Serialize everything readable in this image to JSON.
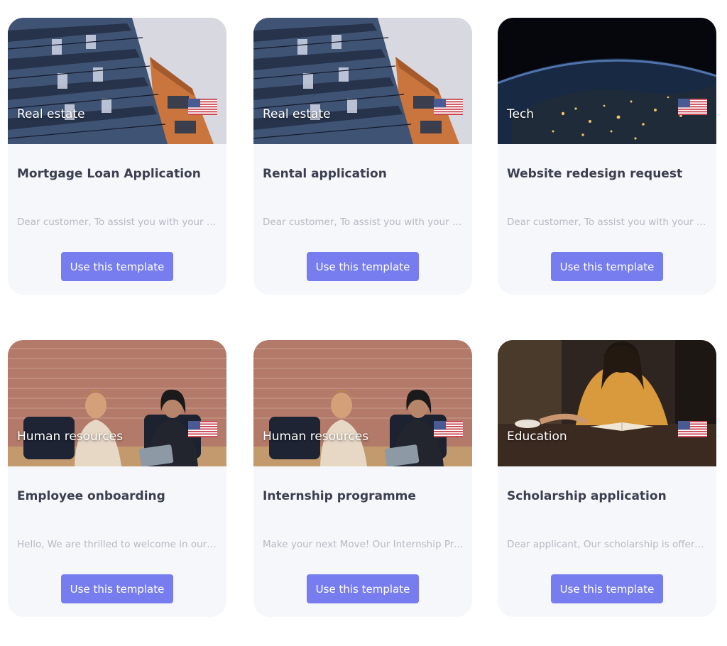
{
  "colors": {
    "card_bg": "#f6f7fa",
    "button_bg": "#777dee",
    "button_text": "#ffffff",
    "title_text": "#3b3f50",
    "desc_text": "#b6b9c4"
  },
  "templates": [
    {
      "category": "Real estate",
      "flag_icon": "us-flag-icon",
      "image": "apartment-building-image",
      "title": "Mortgage Loan Application",
      "description": "Dear customer, To assist you with your Mortgage Loan Application",
      "button_label": "Use this template"
    },
    {
      "category": "Real estate",
      "flag_icon": "us-flag-icon",
      "image": "apartment-building-image",
      "title": "Rental application",
      "description": "Dear customer, To assist you with your tenancy application",
      "button_label": "Use this template"
    },
    {
      "category": "Tech",
      "flag_icon": "us-flag-icon",
      "image": "earth-at-night-image",
      "title": "Website redesign request",
      "description": "Dear customer, To assist you with your website redesign",
      "button_label": "Use this template"
    },
    {
      "category": "Human resources",
      "flag_icon": "us-flag-icon",
      "image": "office-meeting-image",
      "title": "Employee onboarding",
      "description": "Hello, We are thrilled to welcome in our Company",
      "button_label": "Use this template"
    },
    {
      "category": "Human resources",
      "flag_icon": "us-flag-icon",
      "image": "office-meeting-image",
      "title": "Internship programme",
      "description": "Make your next Move! Our Internship Programme",
      "button_label": "Use this template"
    },
    {
      "category": "Education",
      "flag_icon": "us-flag-icon",
      "image": "student-reading-image",
      "title": "Scholarship application",
      "description": "Dear applicant, Our scholarship is offered to",
      "button_label": "Use this template"
    }
  ]
}
